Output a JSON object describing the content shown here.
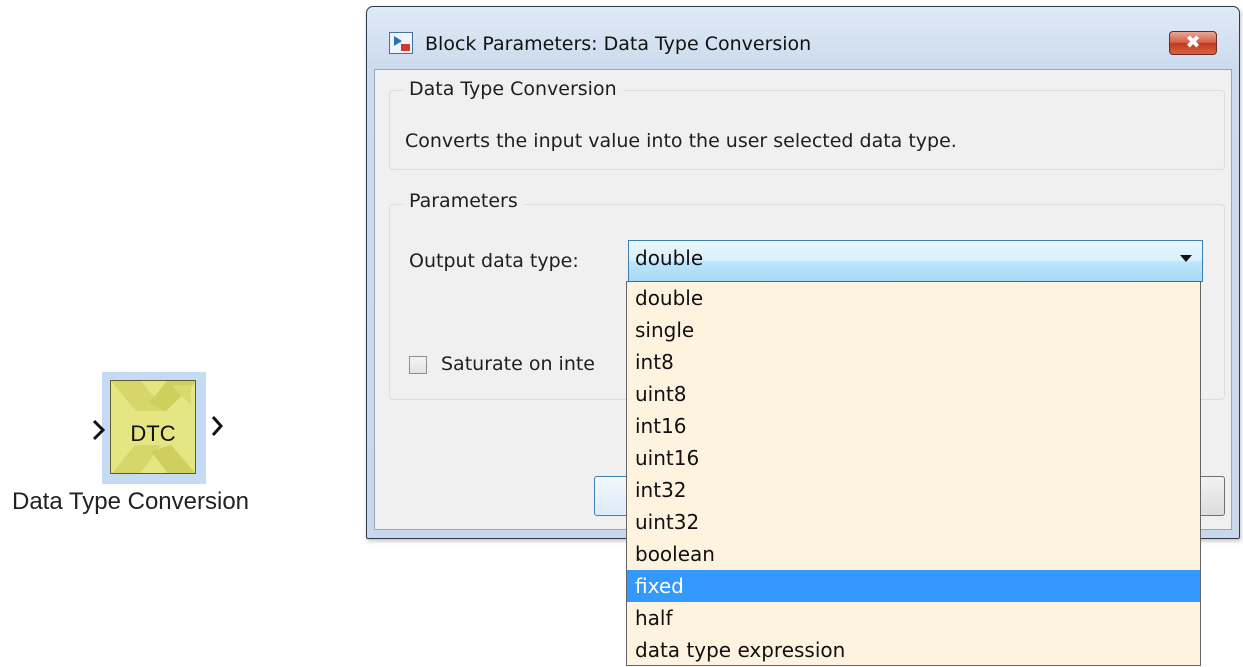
{
  "block": {
    "label": "DTC",
    "name": "Data Type Conversion"
  },
  "dialog": {
    "title": "Block Parameters: Data Type Conversion",
    "close_label": "✖",
    "description_group": {
      "title": "Data Type Conversion",
      "text": "Converts the input value into the user selected data type."
    },
    "parameters_group": {
      "title": "Parameters",
      "output_label": "Output data type:",
      "output_value": "double",
      "saturate_label": "Saturate on inte",
      "saturate_checked": false
    }
  },
  "dropdown": {
    "options": [
      "double",
      "single",
      "int8",
      "uint8",
      "int16",
      "uint16",
      "int32",
      "uint32",
      "boolean",
      "fixed",
      "half",
      "data type expression"
    ],
    "highlighted": "fixed"
  },
  "colors": {
    "block_fill": "#e4e583",
    "selection_highlight": "#3399ff",
    "dropdown_bg": "#fdf3df",
    "close_button": "#c23a1e"
  }
}
